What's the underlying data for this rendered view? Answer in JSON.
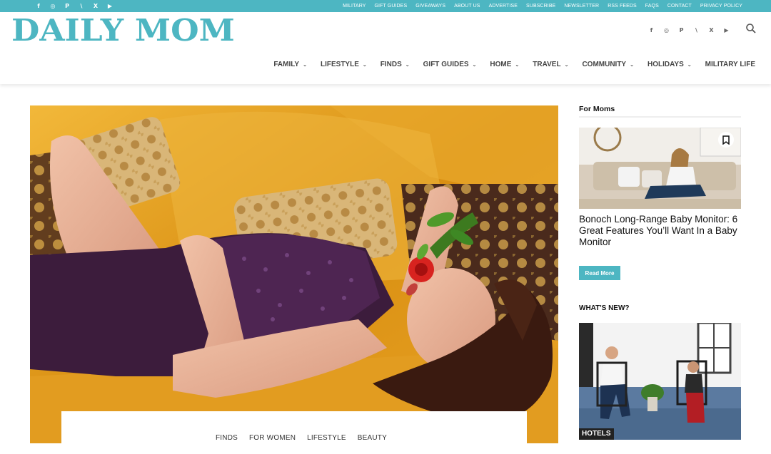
{
  "topbar": {
    "socials": [
      "f",
      "◎",
      "P",
      "\\",
      "X",
      "▶"
    ],
    "social_icons": [
      "facebook-icon",
      "instagram-icon",
      "pinterest-icon",
      "rss-icon",
      "x-icon",
      "youtube-icon"
    ],
    "links": [
      "MILITARY",
      "GIFT GUIDES",
      "GIVEAWAYS",
      "ABOUT US",
      "ADVERTISE",
      "SUBSCRIBE",
      "NEWSLETTER",
      "RSS FEEDS",
      "FAQS",
      "CONTACT",
      "PRIVACY POLICY"
    ]
  },
  "header": {
    "logo": "DAILY MOM",
    "socials": [
      "f",
      "◎",
      "P",
      "\\",
      "X",
      "▶"
    ]
  },
  "nav": [
    "FAMILY",
    "LIFESTYLE",
    "FINDS",
    "GIFT GUIDES",
    "HOME",
    "TRAVEL",
    "COMMUNITY",
    "HOLIDAYS",
    "MILITARY LIFE"
  ],
  "hero": {
    "tags": [
      "FINDS",
      "FOR WOMEN",
      "LIFESTYLE",
      "BEAUTY"
    ]
  },
  "sidebar": {
    "section_title": "For Moms",
    "card_title": "Bonoch Long-Range Baby Monitor: 6 Great Features You’ll Want In a Baby Monitor",
    "read_more": "Read More",
    "whats_new": "WHAT'S NEW?",
    "badge": "HOTELS"
  },
  "colors": {
    "brand": "#4db6c2",
    "nav_text": "#444444"
  }
}
